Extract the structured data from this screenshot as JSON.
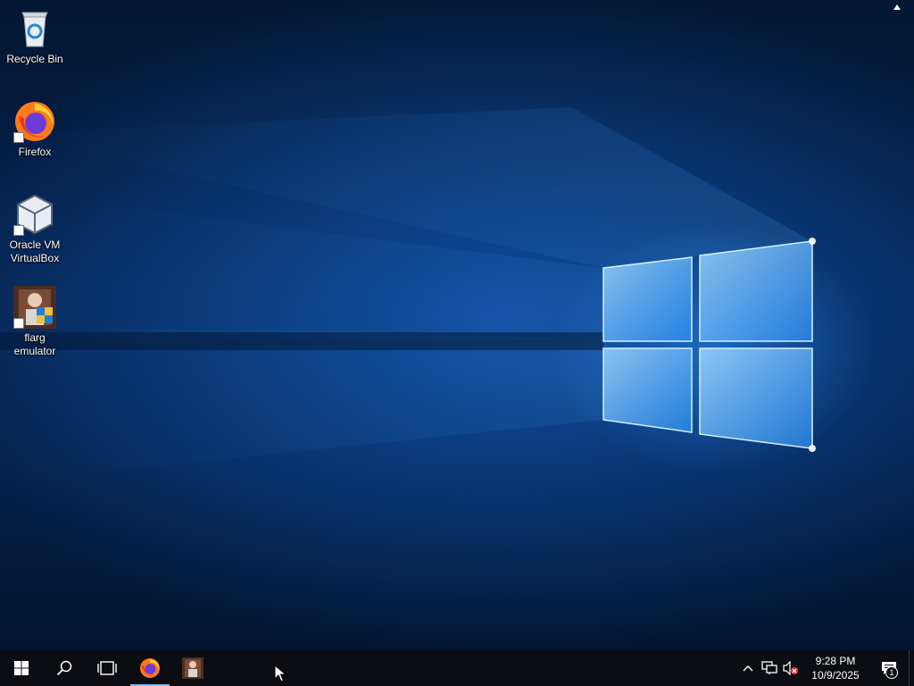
{
  "desktop": {
    "icons": [
      {
        "label": "Recycle Bin",
        "icon": "recycle-bin-icon"
      },
      {
        "label": "Firefox",
        "icon": "firefox-icon"
      },
      {
        "label": "Oracle VM\nVirtualBox",
        "icon": "virtualbox-icon"
      },
      {
        "label": "flarg\nemulator",
        "icon": "flarg-emulator-icon"
      }
    ]
  },
  "taskbar": {
    "start_icon": "windows-start-icon",
    "search_icon": "search-icon",
    "task_view_icon": "task-view-icon",
    "pinned_apps": [
      {
        "name": "Firefox",
        "icon": "firefox-icon",
        "active": true
      },
      {
        "name": "flarg emulator",
        "icon": "flarg-emulator-icon",
        "active": false
      }
    ],
    "tray": {
      "icons": [
        "chevron-up-icon",
        "network-icon",
        "volume-muted-icon"
      ],
      "time": "9:28 PM",
      "date": "10/9/2025",
      "notification_count": "1"
    }
  },
  "colors": {
    "taskbar_bg": "#0b0d12",
    "accent": "#76b9ed",
    "wallpaper_light": "#4fb4ff"
  }
}
